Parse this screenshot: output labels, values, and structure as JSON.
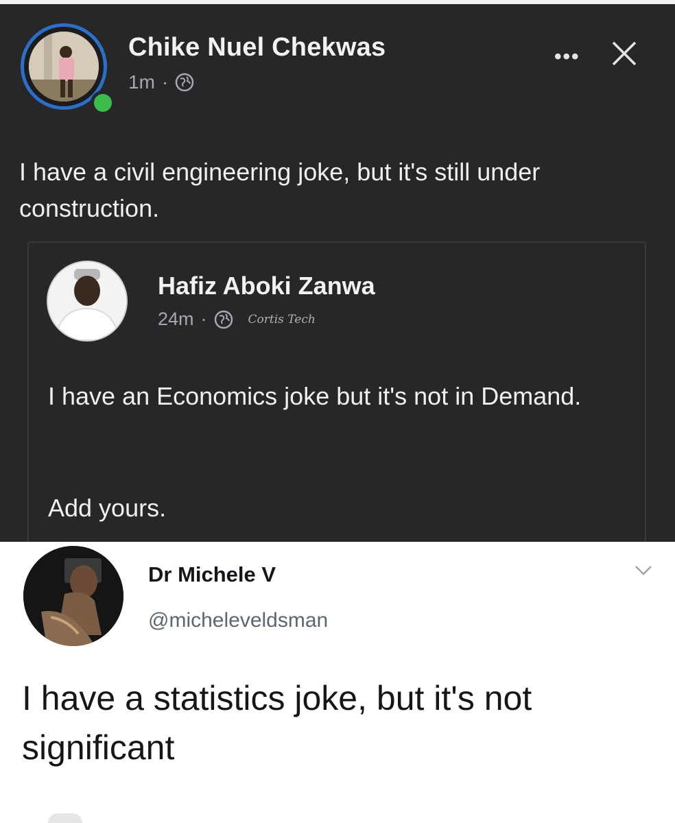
{
  "facebook_post": {
    "author": "Chike Nuel Chekwas",
    "time": "1m",
    "separator": "·",
    "more_label": "•••",
    "text": "I have a civil engineering joke, but it's still under construction.",
    "shared_post": {
      "author": "Hafiz Aboki Zanwa",
      "time": "24m",
      "separator": "·",
      "watermark": "Cortis Tech",
      "text": "I have an Economics joke but it's not in Demand.",
      "cta": "Add yours."
    },
    "colors": {
      "background": "#27272a",
      "online": "#3cbd4b",
      "story_ring": "#2d6fc8"
    }
  },
  "tweet": {
    "name": "Dr Michele V",
    "handle": "@micheleveldsman",
    "text": "I have a statistics joke, but it's not significant"
  }
}
